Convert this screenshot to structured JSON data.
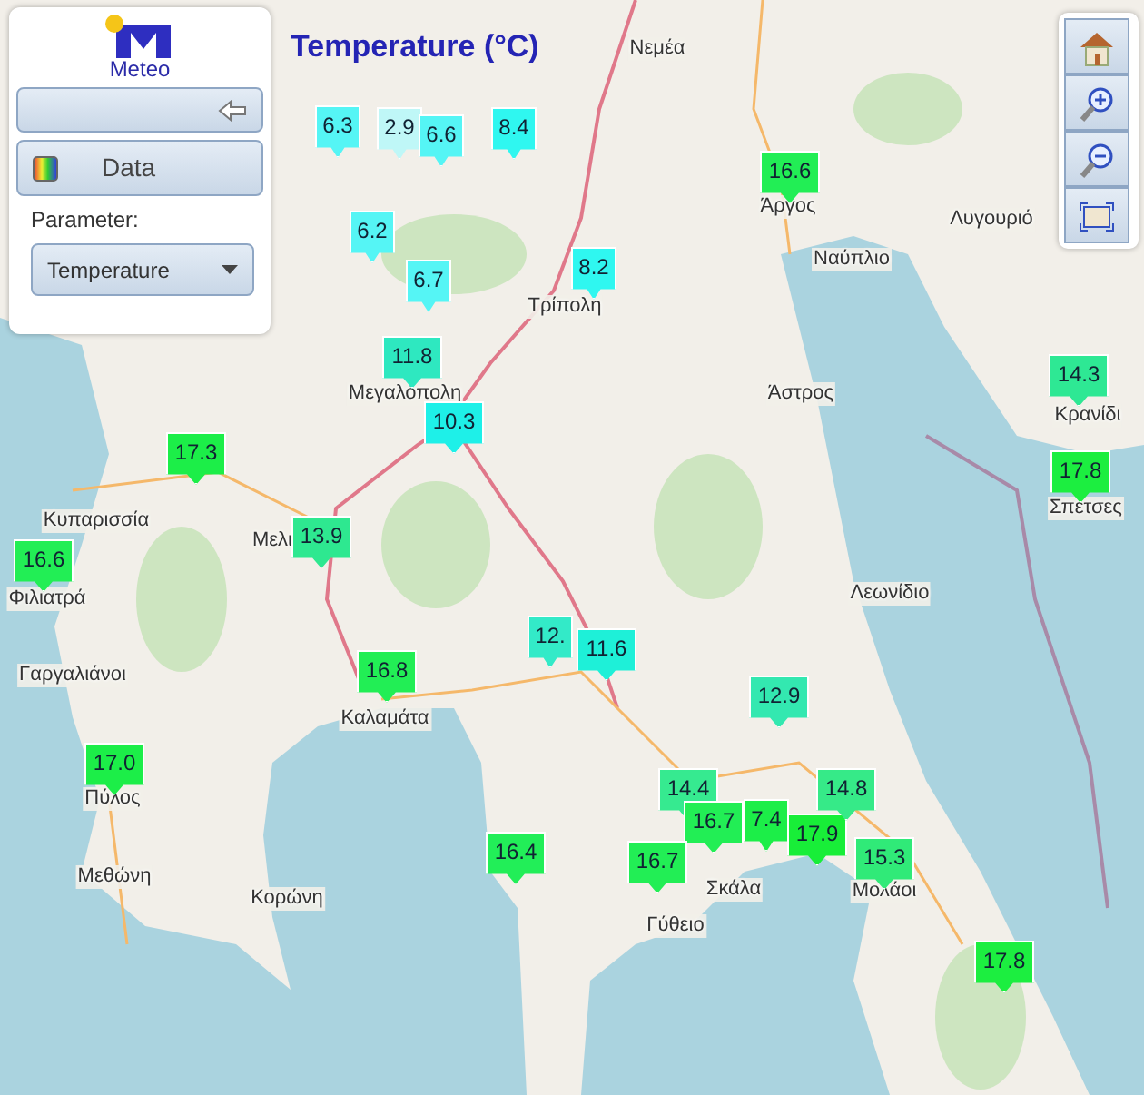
{
  "title": "Temperature (°C)",
  "panel": {
    "logo_text": "Meteo",
    "data_button": "Data",
    "parameter_label": "Parameter:",
    "parameter_select": "Temperature"
  },
  "toolbar": [
    {
      "kind": "home"
    },
    {
      "kind": "zoom_in"
    },
    {
      "kind": "zoom_out"
    },
    {
      "kind": "extent"
    }
  ],
  "places": [
    "Νεμέα",
    "Άργος",
    "Ναύπλιο",
    "Λυγουριό",
    "Τρίπολη",
    "Μεγαλόπολη",
    "Άστρος",
    "Κρανίδι",
    "Σπέτσες",
    "Κυπαρισσία",
    "Μελι",
    "Φιλιατρά",
    "Γαργαλιάνοι",
    "Καλαμάτα",
    "Λεωνίδιο",
    "Σκάλα",
    "Μολάοι",
    "Γύθειο",
    "Πύλος",
    "Μεθώνη",
    "Κορώνη"
  ],
  "markers": [
    {
      "value": "6.3",
      "color": "#55f5f5"
    },
    {
      "value": "2.9",
      "color": "#bff7f7"
    },
    {
      "value": "6.6",
      "color": "#55f5f5"
    },
    {
      "value": "8.4",
      "color": "#2ff7f0"
    },
    {
      "value": "16.6",
      "color": "#22ee55"
    },
    {
      "value": "6.2",
      "color": "#55f5f5"
    },
    {
      "value": "6.7",
      "color": "#55f5f5"
    },
    {
      "value": "8.2",
      "color": "#2ff7f0"
    },
    {
      "value": "11.8",
      "color": "#2ee8c0"
    },
    {
      "value": "10.3",
      "color": "#1ef0e8"
    },
    {
      "value": "17.3",
      "color": "#1cee48"
    },
    {
      "value": "13.9",
      "color": "#2ee890"
    },
    {
      "value": "16.6",
      "color": "#22ee55"
    },
    {
      "value": "16.8",
      "color": "#22ee55"
    },
    {
      "value": "12.",
      "color": "#33eac8"
    },
    {
      "value": "11.6",
      "color": "#1ef0d8"
    },
    {
      "value": "12.9",
      "color": "#33e8b0"
    },
    {
      "value": "14.3",
      "color": "#2ee894"
    },
    {
      "value": "17.8",
      "color": "#1cee40"
    },
    {
      "value": "14.4",
      "color": "#36ea90"
    },
    {
      "value": "16.7",
      "color": "#22ee55"
    },
    {
      "value": "7.4",
      "color": "#1cee48"
    },
    {
      "value": "17.9",
      "color": "#18ee38"
    },
    {
      "value": "14.8",
      "color": "#36ea88"
    },
    {
      "value": "16.4",
      "color": "#22ee58"
    },
    {
      "value": "16.7",
      "color": "#22ee55"
    },
    {
      "value": "15.3",
      "color": "#30ea78"
    },
    {
      "value": "17.0",
      "color": "#1cee48"
    },
    {
      "value": "17.8",
      "color": "#1cee40"
    }
  ]
}
